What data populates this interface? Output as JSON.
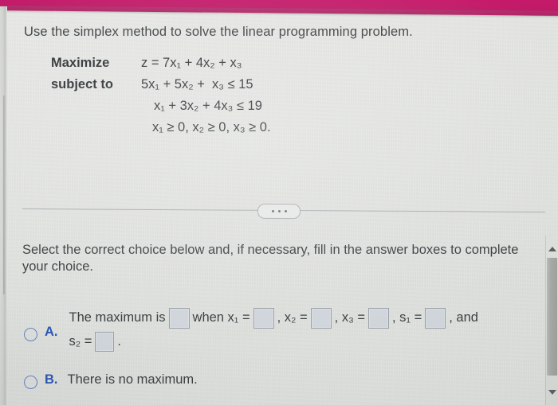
{
  "page": {
    "background_color": "#e4e6e3",
    "accent_band_color": "#c11a68",
    "radio_color": "#2b55b5",
    "answer_box_fill": "#cfd5db"
  },
  "question": {
    "intro": "Use the simplex method to solve the linear programming problem.",
    "math": {
      "objective_label": "Maximize",
      "objective": "z = 7x₁ + 4x₂ + x₃",
      "constraint_label": "subject to",
      "constraints": [
        "5x₁ + 5x₂ +  x₃ ≤ 15",
        "x₁ + 3x₂ + 4x₃ ≤ 19",
        "x₁ ≥ 0, x₂ ≥ 0, x₃ ≥ 0."
      ]
    }
  },
  "divider": {
    "dots": "•••"
  },
  "instructions": {
    "text": "Select the correct choice below and, if necessary, fill in the answer boxes to complete your choice."
  },
  "choices": [
    {
      "letter": "A.",
      "selected": false,
      "line1": {
        "lead": "The maximum is",
        "when": "when x₁ =",
        "x2": ", x₂ =",
        "x3": ", x₃ =",
        "s1": ", s₁ =",
        "tail": ", and"
      },
      "line2": {
        "s2": "s₂ =",
        "period": "."
      },
      "box_values": [
        "",
        "",
        "",
        "",
        "",
        ""
      ]
    },
    {
      "letter": "B.",
      "selected": false,
      "label": "There is no maximum."
    }
  ],
  "scrollbar": {
    "up_arrow": "▲",
    "down_arrow": "▼",
    "position_pct": 18
  }
}
